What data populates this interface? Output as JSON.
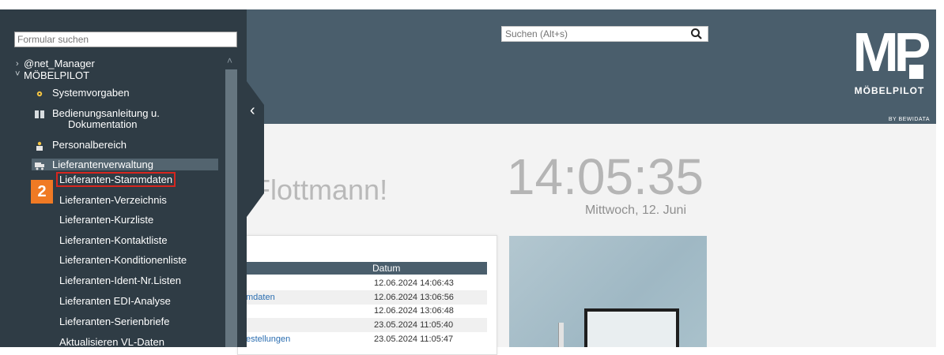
{
  "sidebar": {
    "search_placeholder": "Formular suchen",
    "tree": {
      "manager": "@net_Manager",
      "moebelpilot": "MÖBELPILOT",
      "systemvorgaben": "Systemvorgaben",
      "bedienung_line1": "Bedienungsanleitung u.",
      "bedienung_line2": "Dokumentation",
      "personalbereich": "Personalbereich",
      "lieferantenverwaltung": "Lieferantenverwaltung"
    },
    "items": [
      {
        "label": "Lieferanten-Stammdaten",
        "highlighted": true
      },
      {
        "label": "Lieferanten-Verzeichnis"
      },
      {
        "label": "Lieferanten-Kurzliste"
      },
      {
        "label": "Lieferanten-Kontaktliste"
      },
      {
        "label": "Lieferanten-Konditionenliste"
      },
      {
        "label": "Lieferanten-Ident-Nr.Listen"
      },
      {
        "label": "Lieferanten EDI-Analyse"
      },
      {
        "label": "Lieferanten-Serienbriefe"
      },
      {
        "label": "Aktualisieren VL-Daten"
      }
    ],
    "step_badge": "2"
  },
  "header": {
    "search_placeholder": "Suchen (Alt+s)",
    "logo": {
      "mark": "MP",
      "brand": "MÖBELPILOT",
      "by": "BY BEWIDATA"
    }
  },
  "main": {
    "greeting": "Flottmann!",
    "clock": "14:05:35",
    "date": "Mittwoch, 12. Juni",
    "recent": {
      "column_date": "Datum",
      "rows": [
        {
          "name": "",
          "date": "12.06.2024 14:06:43"
        },
        {
          "name": "mdaten",
          "date": "12.06.2024 13:06:56"
        },
        {
          "name": "",
          "date": "12.06.2024 13:06:48"
        },
        {
          "name": "",
          "date": "23.05.2024 11:05:40"
        },
        {
          "name": "estellungen",
          "date": "23.05.2024 11:05:47"
        }
      ]
    }
  },
  "colors": {
    "header_bg": "#4a5e6c",
    "sidebar_bg": "#2f3c45",
    "highlight": "#d7261e",
    "badge": "#f07a24",
    "link": "#2a6db0"
  }
}
